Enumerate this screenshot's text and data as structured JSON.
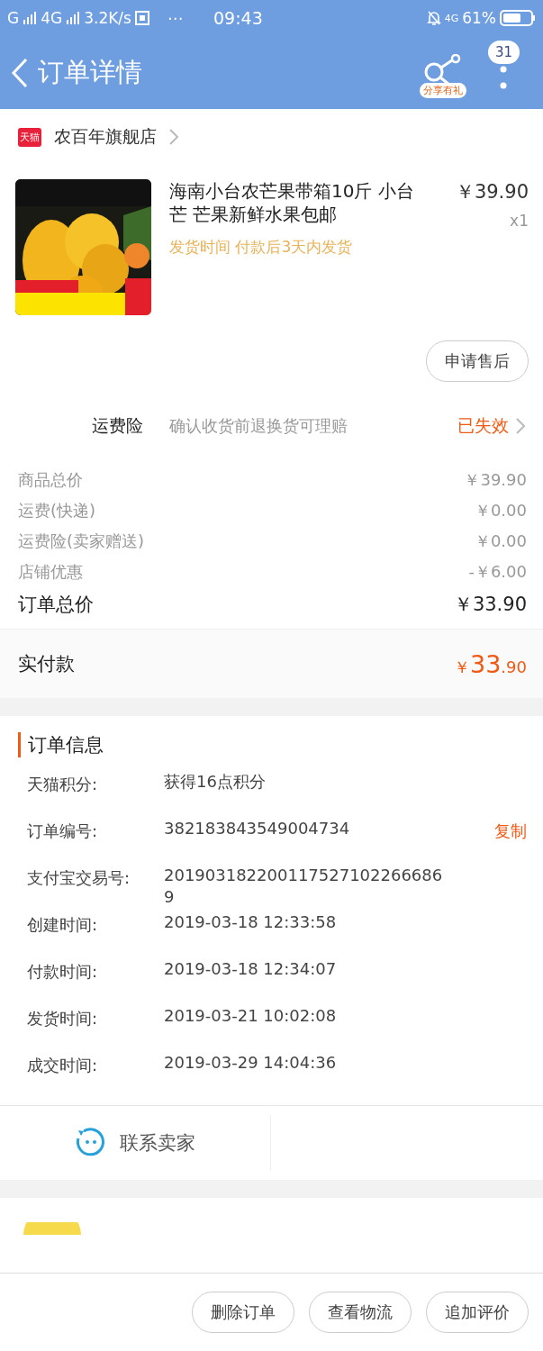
{
  "status_bar": {
    "network_1": "G",
    "network_2": "4G",
    "speed": "3.2K/s",
    "more": "⋯",
    "time": "09:43",
    "network_3": "4G",
    "battery": "61%"
  },
  "header": {
    "title": "订单详情",
    "share_label": "分享有礼",
    "badge": "31"
  },
  "shop": {
    "badge": "天猫",
    "name": "农百年旗舰店"
  },
  "product": {
    "title": "海南小台农芒果带箱10斤 小台芒 芒果新鲜水果包邮",
    "ship_time": "发货时间 付款后3天内发货",
    "price": "￥39.90",
    "quantity": "x1",
    "after_sale_button": "申请售后"
  },
  "insurance": {
    "label": "运费险",
    "description": "确认收货前退换货可理赔",
    "status": "已失效"
  },
  "fees": [
    {
      "label": "商品总价",
      "value": "￥39.90",
      "kind": "line"
    },
    {
      "label": "运费(快递)",
      "value": "￥0.00",
      "kind": "line"
    },
    {
      "label": "运费险(卖家赠送)",
      "value": "￥0.00",
      "kind": "line"
    },
    {
      "label": "店铺优惠",
      "value": "-￥6.00",
      "kind": "line"
    },
    {
      "label": "订单总价",
      "value": "￥33.90",
      "kind": "total"
    }
  ],
  "paid": {
    "label": "实付款",
    "currency": "￥",
    "integer": "33",
    "decimal": ".90"
  },
  "order_info": {
    "title": "订单信息",
    "rows": [
      {
        "label": "天猫积分:",
        "value": "获得16点积分"
      },
      {
        "label": "订单编号:",
        "value": "382183843549004734",
        "action": "复制"
      },
      {
        "label": "支付宝交易号:",
        "value": "2019031822001175271022666869"
      },
      {
        "label": "创建时间:",
        "value": "2019-03-18 12:33:58"
      },
      {
        "label": "付款时间:",
        "value": "2019-03-18 12:34:07"
      },
      {
        "label": "发货时间:",
        "value": "2019-03-21 10:02:08"
      },
      {
        "label": "成交时间:",
        "value": "2019-03-29 14:04:36"
      }
    ]
  },
  "contact": {
    "label": "联系卖家"
  },
  "bottom_buttons": [
    "删除订单",
    "查看物流",
    "追加评价"
  ]
}
